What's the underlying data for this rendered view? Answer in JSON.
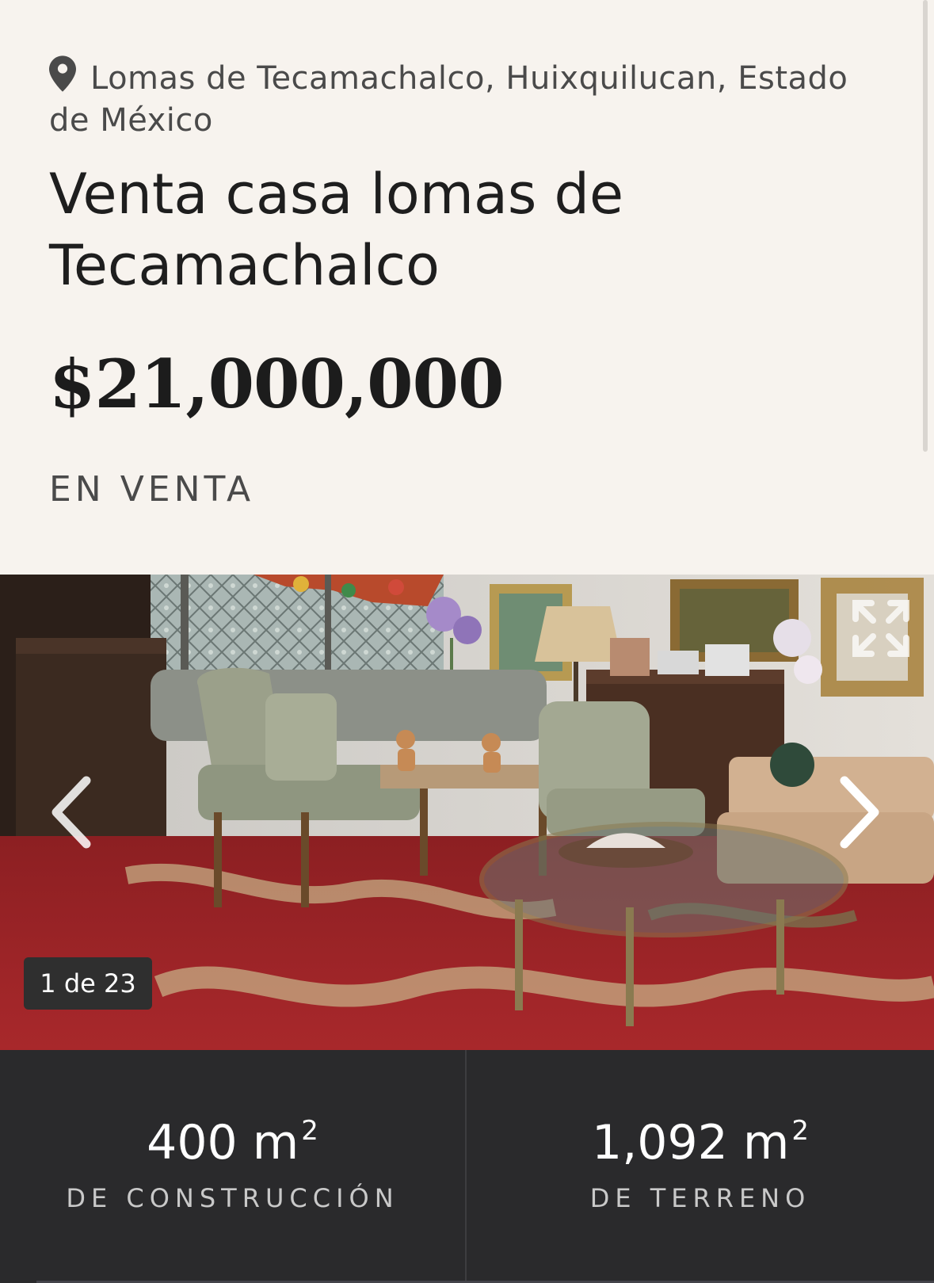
{
  "listing": {
    "location": "Lomas de Tecamachalco, Huixquilucan, Estado de México",
    "title": "Venta casa lomas de Tecamachalco",
    "price": "$21,000,000",
    "status": "EN VENTA"
  },
  "gallery": {
    "counter": "1 de 23",
    "current": 1,
    "total": 23
  },
  "stats": {
    "construction": {
      "value": "400 m",
      "unit_sup": "2",
      "label": "DE CONSTRUCCIÓN"
    },
    "land": {
      "value": "1,092 m",
      "unit_sup": "2",
      "label": "DE TERRENO"
    }
  },
  "colors": {
    "background": "#f7f3ee",
    "stats_background": "#2a2a2c",
    "text_dark": "#1e1e1e",
    "text_muted": "#4a4a4a"
  },
  "icons": {
    "location": "map-pin-icon",
    "prev": "chevron-left-icon",
    "next": "chevron-right-icon",
    "expand": "expand-icon"
  }
}
